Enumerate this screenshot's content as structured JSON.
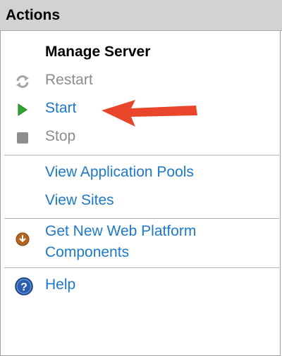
{
  "panel": {
    "title": "Actions"
  },
  "manage_server": {
    "title": "Manage Server",
    "restart_label": "Restart",
    "start_label": "Start",
    "stop_label": "Stop"
  },
  "links": {
    "view_app_pools": "View Application Pools",
    "view_sites": "View Sites",
    "get_components_line1": "Get New Web Platform",
    "get_components_line2": "Components",
    "help": "Help"
  },
  "colors": {
    "link": "#1e78c8",
    "disabled": "#8c8c8c",
    "header_bg": "#d2d2d2",
    "annotation_arrow": "#e8452a",
    "start_icon": "#2fa72f"
  },
  "icons": {
    "restart": "restart-icon",
    "start": "play-icon",
    "stop": "stop-icon",
    "get_components": "download-icon",
    "help": "help-icon"
  }
}
